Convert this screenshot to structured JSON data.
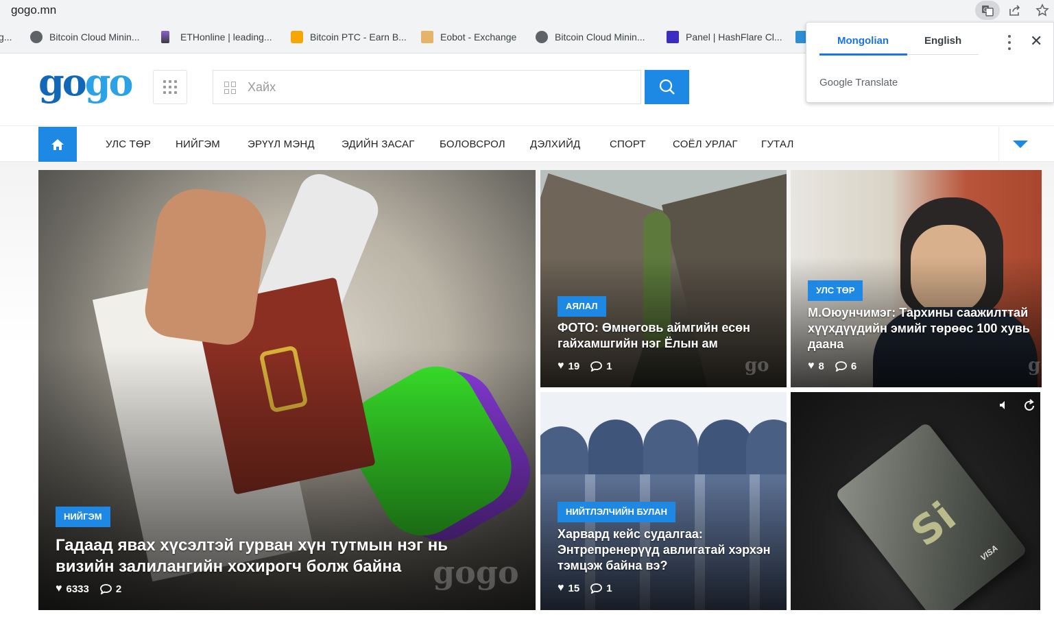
{
  "browser": {
    "url": "gogo.mn",
    "bookmarks": [
      {
        "label": "g..."
      },
      {
        "label": "Bitcoin Cloud Minin..."
      },
      {
        "label": "ETHonline | leading..."
      },
      {
        "label": "Bitcoin PTC - Earn B..."
      },
      {
        "label": "Eobot - Exchange"
      },
      {
        "label": "Bitcoin Cloud Minin..."
      },
      {
        "label": "Panel | HashFlare Cl..."
      }
    ]
  },
  "translate_popup": {
    "tab_active": "Mongolian",
    "tab_inactive": "English",
    "brand": "Google Translate"
  },
  "header": {
    "logo_part1": "go",
    "logo_part2": "go",
    "search_placeholder": "Хайх"
  },
  "nav": {
    "items": [
      "УЛС ТӨР",
      "НИЙГЭМ",
      "ЭРҮҮЛ МЭНД",
      "ЭДИЙН ЗАСАГ",
      "БОЛОВСРОЛ",
      "ДЭЛХИЙД",
      "СПОРТ",
      "СОЁЛ УРЛАГ",
      "ГУТАЛ"
    ]
  },
  "articles": {
    "main": {
      "category": "НИЙГЭМ",
      "title": "Гадаад явах хүсэлтэй гурван хүн тутмын нэг нь визийн залилангийн хохирогч болж байна",
      "likes": "6333",
      "comments": "2",
      "watermark": "gogo"
    },
    "top_middle": {
      "category": "АЯЛАЛ",
      "title": "ФОТО: Өмнөговь аймгийн есөн гайхамшгийн нэг Ёлын ам",
      "likes": "19",
      "comments": "1",
      "watermark": "go"
    },
    "top_right": {
      "category": "УЛС ТӨР",
      "title": "М.Оюунчимэг: Тархины саажилттай хүүхдүүдийн эмийг төрөөс 100 хувь даана",
      "likes": "8",
      "comments": "6",
      "watermark": "g"
    },
    "bottom_middle": {
      "category": "НИЙТЛЭЛЧИЙН БУЛАН",
      "title": "Харвард кейс судалгаа: Энтрепренерүүд авлигатай хэрхэн тэмцэж байна вэ?",
      "likes": "15",
      "comments": "1"
    },
    "ad": {
      "card_text": "Si",
      "card_brand": "VISA"
    }
  },
  "colors": {
    "accent": "#1e88e5",
    "logo_dark": "#1268b7",
    "logo_light": "#2ba2e6"
  }
}
